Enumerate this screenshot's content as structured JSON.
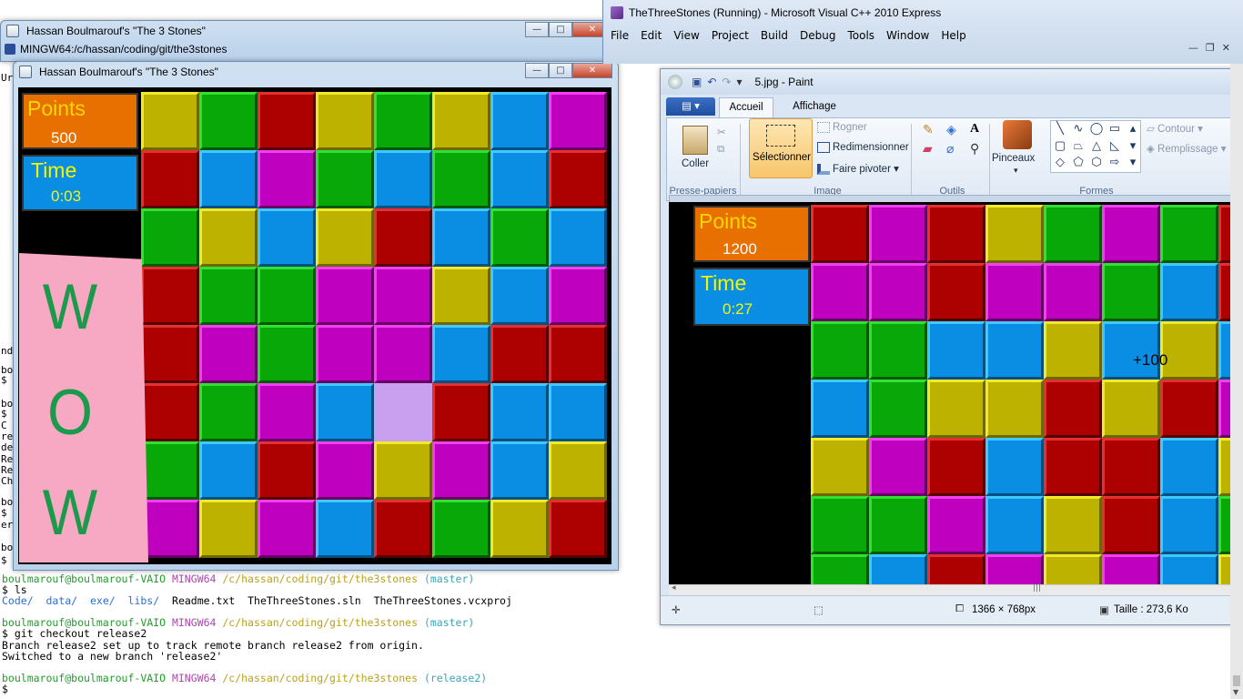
{
  "terminal": {
    "title": "MINGW64:/c/hassan/coding/git/the3stones",
    "edge_fragments": [
      "Ur",
      "nd",
      "bo",
      "$",
      "bo",
      "$",
      "C",
      "re",
      "de",
      "Re",
      "Re",
      "Ch",
      "bo",
      "$",
      "er",
      "bo",
      "$"
    ],
    "lines": [
      {
        "user": "boulmarouf@boulmarouf-VAIO",
        "shell": "MINGW64",
        "path": "/c/hassan/coding/git/the3stones",
        "branch": "(master)"
      },
      {
        "text": "$ ls"
      },
      {
        "dirs": [
          "Code/",
          "data/",
          "exe/",
          "libs/"
        ],
        "files": "Readme.txt  TheThreeStones.sln  TheThreeStones.vcxproj"
      },
      {
        "text": ""
      },
      {
        "user": "boulmarouf@boulmarouf-VAIO",
        "shell": "MINGW64",
        "path": "/c/hassan/coding/git/the3stones",
        "branch": "(master)"
      },
      {
        "text": "$ git checkout release2"
      },
      {
        "text": "Branch release2 set up to track remote branch release2 from origin."
      },
      {
        "text": "Switched to a new branch 'release2'"
      },
      {
        "text": ""
      },
      {
        "user": "boulmarouf@boulmarouf-VAIO",
        "shell": "MINGW64",
        "path": "/c/hassan/coding/git/the3stones",
        "branch": "(release2)"
      },
      {
        "text": "$ "
      }
    ]
  },
  "game_back": {
    "title": "Hassan Boulmarouf's \"The 3 Stones\""
  },
  "game_front": {
    "title": "Hassan Boulmarouf's \"The 3 Stones\"",
    "points_label": "Points",
    "points_value": "500",
    "time_label": "Time",
    "time_value": "0:03",
    "wow": [
      "W",
      "O",
      "W"
    ],
    "grid": [
      [
        "yellow",
        "green",
        "red",
        "yellow",
        "green",
        "yellow",
        "blue",
        "purple"
      ],
      [
        "red",
        "blue",
        "purple",
        "green",
        "blue",
        "green",
        "blue",
        "red"
      ],
      [
        "green",
        "yellow",
        "blue",
        "yellow",
        "red",
        "blue",
        "green",
        "blue"
      ],
      [
        "red",
        "green",
        "green",
        "purple",
        "purple",
        "yellow",
        "blue",
        "purple"
      ],
      [
        "red",
        "purple",
        "green",
        "purple",
        "purple",
        "blue",
        "red",
        "red"
      ],
      [
        "red",
        "green",
        "purple",
        "blue",
        "lilac",
        "red",
        "blue",
        "blue"
      ],
      [
        "green",
        "blue",
        "red",
        "purple",
        "yellow",
        "purple",
        "blue",
        "yellow"
      ],
      [
        "purple",
        "yellow",
        "purple",
        "blue",
        "red",
        "green",
        "yellow",
        "red"
      ]
    ]
  },
  "vs": {
    "title": "TheThreeStones (Running) - Microsoft Visual C++ 2010 Express",
    "menu": [
      "File",
      "Edit",
      "View",
      "Project",
      "Build",
      "Debug",
      "Tools",
      "Window",
      "Help"
    ]
  },
  "paint": {
    "title": "5.jpg - Paint",
    "tabs": [
      "Accueil",
      "Affichage"
    ],
    "groups": {
      "clipboard": {
        "label": "Presse-papiers",
        "paste": "Coller"
      },
      "image": {
        "label": "Image",
        "select": "Sélectionner",
        "crop": "Rogner",
        "resize": "Redimensionner",
        "rotate": "Faire pivoter"
      },
      "tools": {
        "label": "Outils"
      },
      "brushes": {
        "label": "Pinceaux"
      },
      "shapes": {
        "label": "Formes",
        "outline": "Contour",
        "fill": "Remplissage"
      }
    },
    "status": {
      "dimensions": "1366 × 768px",
      "size": "Taille : 273,6 Ko"
    },
    "image": {
      "points_label": "Points",
      "points_value": "1200",
      "time_label": "Time",
      "time_value": "0:27",
      "bonus": "+100",
      "grid": [
        [
          "red",
          "purple",
          "red",
          "yellow",
          "green",
          "purple",
          "green",
          "red"
        ],
        [
          "purple",
          "purple",
          "red",
          "purple",
          "purple",
          "green",
          "blue",
          "red"
        ],
        [
          "green",
          "green",
          "blue",
          "blue",
          "yellow",
          "blue",
          "yellow",
          "blue"
        ],
        [
          "blue",
          "green",
          "yellow",
          "yellow",
          "red",
          "yellow",
          "red",
          "purple"
        ],
        [
          "yellow",
          "purple",
          "red",
          "blue",
          "red",
          "red",
          "blue",
          "yellow"
        ],
        [
          "green",
          "green",
          "purple",
          "blue",
          "yellow",
          "red",
          "blue",
          "green"
        ],
        [
          "green",
          "blue",
          "red",
          "purple",
          "yellow",
          "purple",
          "blue",
          "yellow"
        ]
      ]
    }
  }
}
